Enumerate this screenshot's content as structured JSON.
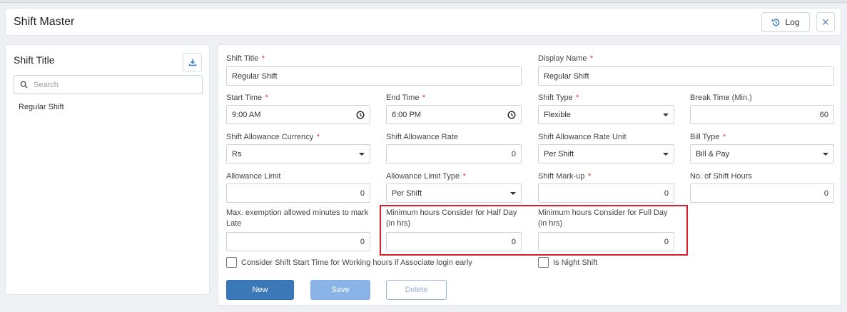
{
  "header": {
    "title": "Shift Master",
    "log_label": "Log",
    "close_symbol": "✕"
  },
  "sidebar": {
    "title": "Shift Title",
    "search_placeholder": "Search",
    "items": [
      {
        "label": "Regular Shift"
      }
    ]
  },
  "form": {
    "shift_title": {
      "label": "Shift Title",
      "value": "Regular Shift"
    },
    "display_name": {
      "label": "Display Name",
      "value": "Regular Shift"
    },
    "start_time": {
      "label": "Start Time",
      "value": "9:00 AM"
    },
    "end_time": {
      "label": "End Time",
      "value": "6:00 PM"
    },
    "shift_type": {
      "label": "Shift Type",
      "value": "Flexible"
    },
    "break_time": {
      "label": "Break Time (Min.)",
      "value": "60"
    },
    "allowance_currency": {
      "label": "Shift Allowance Currency",
      "value": "Rs"
    },
    "allowance_rate": {
      "label": "Shift Allowance Rate",
      "value": "0"
    },
    "allowance_rate_unit": {
      "label": "Shift Allowance Rate Unit",
      "value": "Per Shift"
    },
    "bill_type": {
      "label": "Bill Type",
      "value": "Bill & Pay"
    },
    "allowance_limit": {
      "label": "Allowance Limit",
      "value": "0"
    },
    "allowance_limit_type": {
      "label": "Allowance Limit Type",
      "value": "Per Shift"
    },
    "shift_markup": {
      "label": "Shift Mark-up",
      "value": "0"
    },
    "shift_hours": {
      "label": "No. of Shift Hours",
      "value": "0"
    },
    "max_exemption": {
      "label_line1": "Max. exemption allowed minutes to mark",
      "label_line2": "Late",
      "value": "0"
    },
    "min_half_day": {
      "label_line1": "Minimum hours Consider for Half Day",
      "label_line2": "(in hrs)",
      "value": "0"
    },
    "min_full_day": {
      "label_line1": "Minimum hours Consider for Full Day",
      "label_line2": "(in hrs)",
      "value": "0"
    },
    "consider_start_time": {
      "label": "Consider Shift Start Time for Working hours if Associate login early",
      "checked": false
    },
    "is_night_shift": {
      "label": "Is Night Shift",
      "checked": false
    },
    "required_mark": "*"
  },
  "buttons": {
    "new": "New",
    "save": "Save",
    "delete": "Delete"
  },
  "colors": {
    "primary": "#3b78b8",
    "save_disabled": "#8ab4e8",
    "highlight": "#d8202a",
    "required": "#dd3333"
  }
}
